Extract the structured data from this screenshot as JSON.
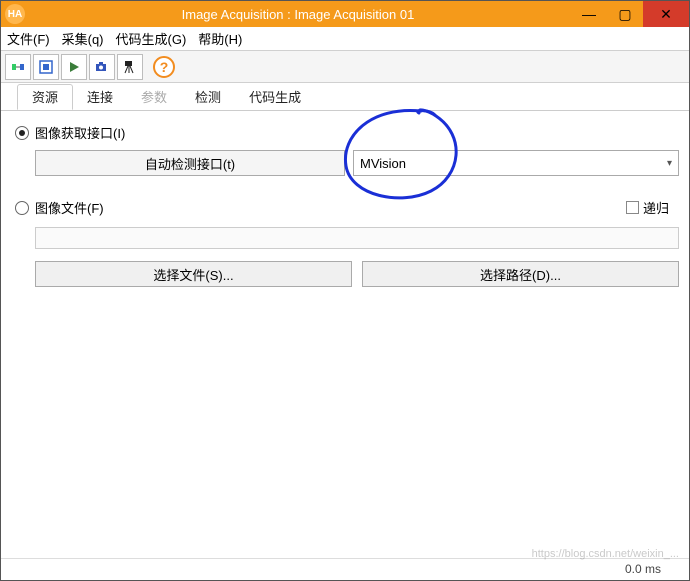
{
  "window": {
    "title": "Image Acquisition : Image Acquisition 01",
    "app_icon_text": "HA"
  },
  "menus": {
    "file": "文件(F)",
    "acquire": "采集(q)",
    "codegen": "代码生成(G)",
    "help": "帮助(H)"
  },
  "tabs": {
    "t0": "资源",
    "t1": "连接",
    "t2": "参数",
    "t3": "检测",
    "t4": "代码生成"
  },
  "form": {
    "radio_interface": "图像获取接口(I)",
    "autodetect_btn": "自动检测接口(t)",
    "combo_selected": "MVision",
    "radio_file": "图像文件(F)",
    "recurse": "递归",
    "select_file_btn": "选择文件(S)...",
    "select_path_btn": "选择路径(D)..."
  },
  "status": {
    "text": "0.0 ms"
  },
  "watermark": "https://blog.csdn.net/weixin_..."
}
